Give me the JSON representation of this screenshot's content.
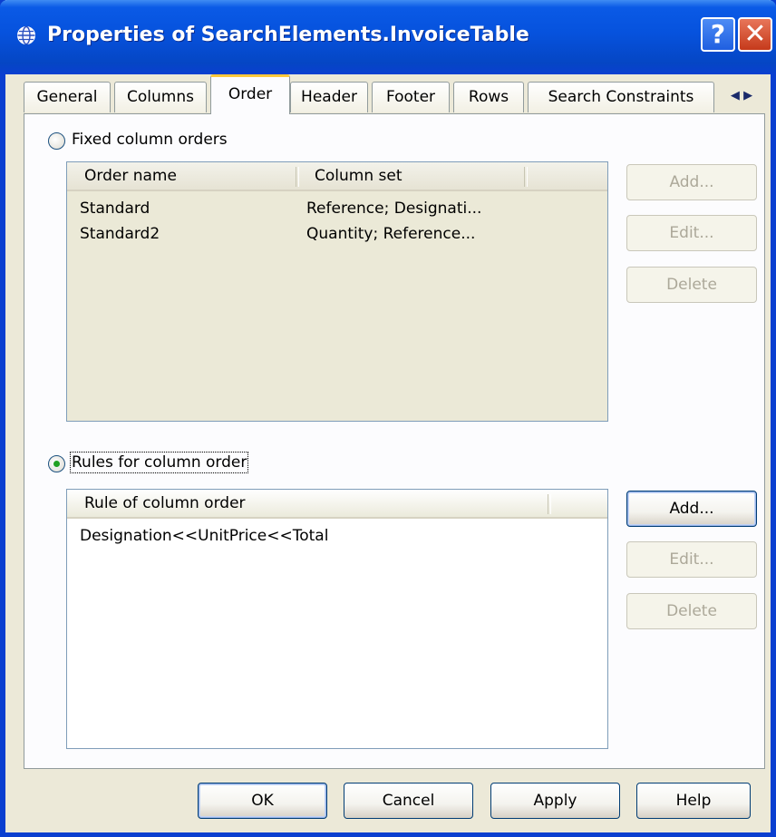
{
  "window": {
    "title": "Properties of SearchElements.InvoiceTable",
    "help_glyph": "?",
    "close_glyph": "✕",
    "title_icon": "globe-icon"
  },
  "tabs": [
    {
      "label": "General"
    },
    {
      "label": "Columns"
    },
    {
      "label": "Order",
      "active": true
    },
    {
      "label": "Header"
    },
    {
      "label": "Footer"
    },
    {
      "label": "Rows"
    },
    {
      "label": "Search Constraints"
    }
  ],
  "tab_scroll": {
    "left": "◀",
    "right": "▶"
  },
  "fixed_orders": {
    "radio_label": "Fixed column orders",
    "selected": false,
    "columns": [
      "Order name",
      "Column set"
    ],
    "rows": [
      {
        "name": "Standard",
        "columns": "Reference; Designati..."
      },
      {
        "name": "Standard2",
        "columns": "Quantity; Reference..."
      }
    ],
    "buttons": {
      "add": "Add...",
      "edit": "Edit...",
      "delete": "Delete"
    }
  },
  "rules": {
    "radio_label": "Rules for column order",
    "selected": true,
    "columns": [
      "Rule of column order"
    ],
    "rows": [
      "Designation<<UnitPrice<<Total"
    ],
    "buttons": {
      "add": "Add...",
      "edit": "Edit...",
      "delete": "Delete"
    }
  },
  "footer": {
    "ok": "OK",
    "cancel": "Cancel",
    "apply": "Apply",
    "help": "Help"
  },
  "colors": {
    "titlebar": "#0652dd",
    "dialog_bg": "#ece9d8",
    "active_tab_accent": "#ffc83c",
    "radio_dot": "#21a121"
  }
}
